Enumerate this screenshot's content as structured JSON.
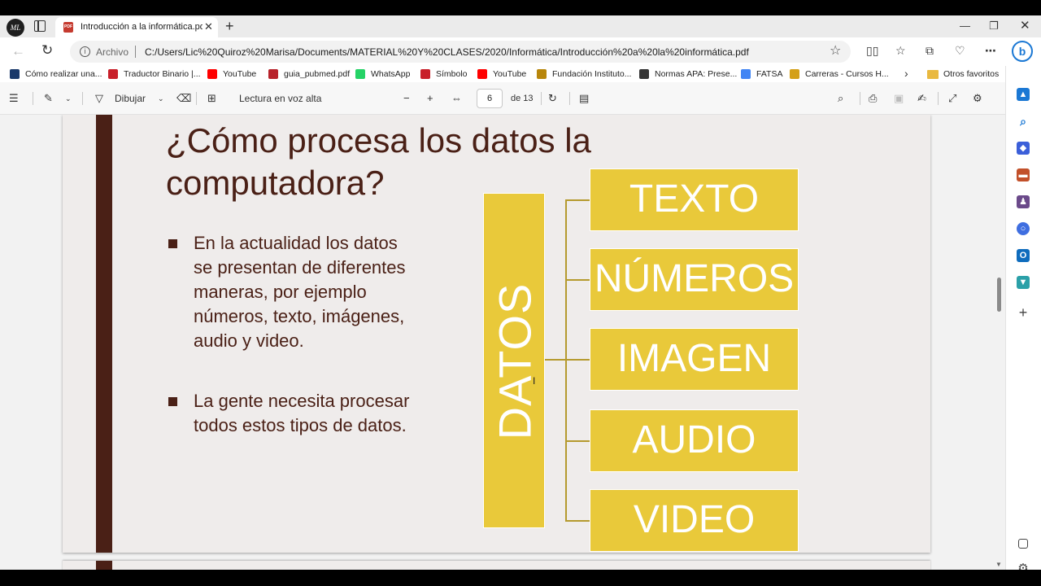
{
  "tab": {
    "title": "Introducción a la informática.pdf",
    "close": "✕",
    "new_tab": "+"
  },
  "profile": {
    "initials": "ML"
  },
  "window_controls": {
    "minimize": "—",
    "restore": "❐",
    "close": "✕"
  },
  "address": {
    "site_label": "Archivo",
    "url": "C:/Users/Lic%20Quiroz%20Marisa/Documents/MATERIAL%20Y%20CLASES/2020/Informática/Introducción%20a%20la%20informática.pdf"
  },
  "favorites": [
    {
      "label": "Cómo realizar una...",
      "icon": "document-icon",
      "color": "#1a3a6b"
    },
    {
      "label": "Traductor Binario |...",
      "icon": "translator-icon",
      "color": "#c8202a"
    },
    {
      "label": "YouTube",
      "icon": "youtube-icon",
      "color": "#ff0000"
    },
    {
      "label": "guia_pubmed.pdf",
      "icon": "pdf-icon",
      "color": "#b8232b"
    },
    {
      "label": "WhatsApp",
      "icon": "whatsapp-icon",
      "color": "#25d366"
    },
    {
      "label": "Símbolo",
      "icon": "symbol-icon",
      "color": "#c8202a"
    },
    {
      "label": "YouTube",
      "icon": "youtube-icon",
      "color": "#ff0000"
    },
    {
      "label": "Fundación Instituto...",
      "icon": "foundation-icon",
      "color": "#b8860b"
    },
    {
      "label": "Normas APA: Prese...",
      "icon": "apa-icon",
      "color": "#333333"
    },
    {
      "label": "FATSA",
      "icon": "google-icon",
      "color": "#4285f4"
    },
    {
      "label": "Carreras - Cursos H...",
      "icon": "courses-icon",
      "color": "#d4a017"
    }
  ],
  "favorites_folder": "Otros favoritos",
  "pdf_toolbar": {
    "draw_label": "Dibujar",
    "read_aloud_label": "Lectura en voz alta",
    "page_current": "6",
    "page_total": "de 13"
  },
  "slide": {
    "title": "¿Cómo procesa los datos la computadora?",
    "bullets": [
      "En la actualidad los datos se presentan de diferentes maneras, por ejemplo números, texto, imágenes, audio y video.",
      "La gente necesita procesar todos estos tipos de datos."
    ],
    "diagram": {
      "root": "DATOS",
      "items": [
        "TEXTO",
        "NÚMEROS",
        "IMAGEN",
        "AUDIO",
        "VIDEO"
      ]
    }
  },
  "colors": {
    "accent_dark": "#4a2016",
    "diagram_yellow": "#e9c93a",
    "slide_bg": "#efeceb"
  }
}
